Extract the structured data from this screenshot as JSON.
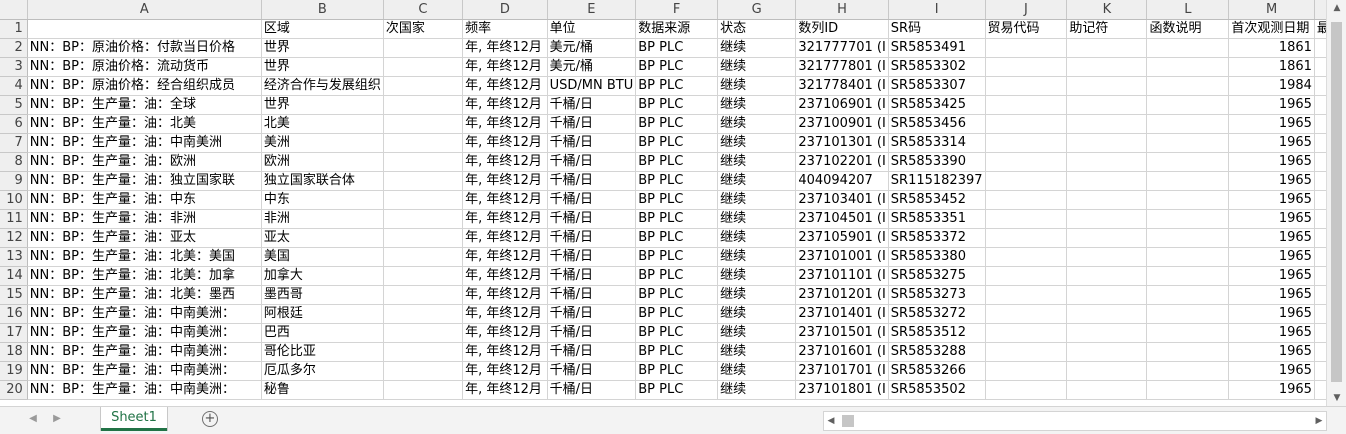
{
  "sheet": {
    "columns": [
      "A",
      "B",
      "C",
      "D",
      "E",
      "F",
      "G",
      "H",
      "I",
      "J",
      "K",
      "L",
      "M"
    ],
    "header": [
      "",
      "区域",
      "次国家",
      "频率",
      "单位",
      "数据来源",
      "状态",
      "数列ID",
      "SR码",
      "贸易代码",
      "助记符",
      "函数说明",
      "首次观测日期",
      "最后"
    ],
    "rows": [
      {
        "num": "2",
        "a": "NN：BP：原油价格：付款当日价格",
        "b": "世界",
        "d": "年, 年终12月",
        "e": "美元/桶",
        "f": "BP PLC",
        "g": "继续",
        "h": "321777701 (I",
        "i": "SR5853491",
        "m": "1861"
      },
      {
        "num": "3",
        "a": "NN：BP：原油价格：流动货币",
        "b": "世界",
        "d": "年, 年终12月",
        "e": "美元/桶",
        "f": "BP PLC",
        "g": "继续",
        "h": "321777801 (I",
        "i": "SR5853302",
        "m": "1861"
      },
      {
        "num": "4",
        "a": "NN：BP：原油价格：经合组织成员",
        "b": "经济合作与发展组织",
        "d": "年, 年终12月",
        "e": "USD/MN BTU",
        "f": "BP PLC",
        "g": "继续",
        "h": "321778401 (I",
        "i": "SR5853307",
        "m": "1984"
      },
      {
        "num": "5",
        "a": "NN：BP：生产量：油：全球",
        "b": "世界",
        "d": "年, 年终12月",
        "e": "千桶/日",
        "f": "BP PLC",
        "g": "继续",
        "h": "237106901 (I",
        "i": "SR5853425",
        "m": "1965"
      },
      {
        "num": "6",
        "a": "NN：BP：生产量：油：北美",
        "b": "北美",
        "d": "年, 年终12月",
        "e": "千桶/日",
        "f": "BP PLC",
        "g": "继续",
        "h": "237100901 (I",
        "i": "SR5853456",
        "m": "1965"
      },
      {
        "num": "7",
        "a": "NN：BP：生产量：油：中南美洲",
        "b": "美洲",
        "d": "年, 年终12月",
        "e": "千桶/日",
        "f": "BP PLC",
        "g": "继续",
        "h": "237101301 (I",
        "i": "SR5853314",
        "m": "1965"
      },
      {
        "num": "8",
        "a": "NN：BP：生产量：油：欧洲",
        "b": "欧洲",
        "d": "年, 年终12月",
        "e": "千桶/日",
        "f": "BP PLC",
        "g": "继续",
        "h": "237102201 (I",
        "i": "SR5853390",
        "m": "1965"
      },
      {
        "num": "9",
        "a": "NN：BP：生产量：油：独立国家联",
        "b": "独立国家联合体",
        "d": "年, 年终12月",
        "e": "千桶/日",
        "f": "BP PLC",
        "g": "继续",
        "h": "404094207",
        "i": "SR115182397",
        "m": "1965"
      },
      {
        "num": "10",
        "a": "NN：BP：生产量：油：中东",
        "b": "中东",
        "d": "年, 年终12月",
        "e": "千桶/日",
        "f": "BP PLC",
        "g": "继续",
        "h": "237103401 (I",
        "i": "SR5853452",
        "m": "1965"
      },
      {
        "num": "11",
        "a": "NN：BP：生产量：油：非洲",
        "b": "非洲",
        "d": "年, 年终12月",
        "e": "千桶/日",
        "f": "BP PLC",
        "g": "继续",
        "h": "237104501 (I",
        "i": "SR5853351",
        "m": "1965"
      },
      {
        "num": "12",
        "a": "NN：BP：生产量：油：亚太",
        "b": "亚太",
        "d": "年, 年终12月",
        "e": "千桶/日",
        "f": "BP PLC",
        "g": "继续",
        "h": "237105901 (I",
        "i": "SR5853372",
        "m": "1965"
      },
      {
        "num": "13",
        "a": "NN：BP：生产量：油：北美：美国",
        "b": "美国",
        "d": "年, 年终12月",
        "e": "千桶/日",
        "f": "BP PLC",
        "g": "继续",
        "h": "237101001 (I",
        "i": "SR5853380",
        "m": "1965"
      },
      {
        "num": "14",
        "a": "NN：BP：生产量：油：北美：加拿",
        "b": "加拿大",
        "d": "年, 年终12月",
        "e": "千桶/日",
        "f": "BP PLC",
        "g": "继续",
        "h": "237101101 (I",
        "i": "SR5853275",
        "m": "1965"
      },
      {
        "num": "15",
        "a": "NN：BP：生产量：油：北美：墨西",
        "b": "墨西哥",
        "d": "年, 年终12月",
        "e": "千桶/日",
        "f": "BP PLC",
        "g": "继续",
        "h": "237101201 (I",
        "i": "SR5853273",
        "m": "1965"
      },
      {
        "num": "16",
        "a": "NN：BP：生产量：油：中南美洲：",
        "b": "阿根廷",
        "d": "年, 年终12月",
        "e": "千桶/日",
        "f": "BP PLC",
        "g": "继续",
        "h": "237101401 (I",
        "i": "SR5853272",
        "m": "1965"
      },
      {
        "num": "17",
        "a": "NN：BP：生产量：油：中南美洲：",
        "b": "巴西",
        "d": "年, 年终12月",
        "e": "千桶/日",
        "f": "BP PLC",
        "g": "继续",
        "h": "237101501 (I",
        "i": "SR5853512",
        "m": "1965"
      },
      {
        "num": "18",
        "a": "NN：BP：生产量：油：中南美洲：",
        "b": "哥伦比亚",
        "d": "年, 年终12月",
        "e": "千桶/日",
        "f": "BP PLC",
        "g": "继续",
        "h": "237101601 (I",
        "i": "SR5853288",
        "m": "1965"
      },
      {
        "num": "19",
        "a": "NN：BP：生产量：油：中南美洲：",
        "b": "厄瓜多尔",
        "d": "年, 年终12月",
        "e": "千桶/日",
        "f": "BP PLC",
        "g": "继续",
        "h": "237101701 (I",
        "i": "SR5853266",
        "m": "1965"
      },
      {
        "num": "20",
        "a": "NN：BP：生产量：油：中南美洲：",
        "b": "秘鲁",
        "d": "年, 年终12月",
        "e": "千桶/日",
        "f": "BP PLC",
        "g": "继续",
        "h": "237101801 (I",
        "i": "SR5853502",
        "m": "1965"
      }
    ]
  },
  "bottom_bar": {
    "sheet_tab": "Sheet1",
    "add_sheet_symbol": "+"
  },
  "icons": {
    "nav_prev": "caret-left-icon",
    "nav_next": "caret-right-icon",
    "add_sheet": "plus-circle-icon",
    "scroll_up": "scroll-up-icon",
    "scroll_down": "scroll-down-icon",
    "scroll_left": "scroll-left-icon",
    "scroll_right": "scroll-right-icon"
  },
  "colors": {
    "accent": "#217346",
    "header_bg": "#efefef",
    "gridline": "#d4d4d4"
  }
}
